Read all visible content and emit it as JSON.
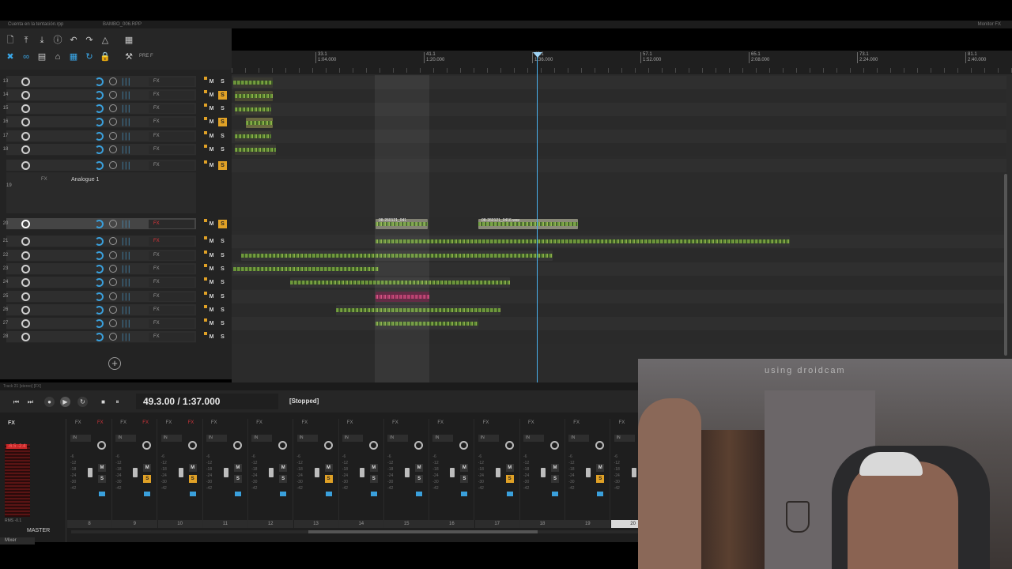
{
  "titlebar": {
    "project_name": "Cuenta en la tentación.rpp",
    "alt_project": "BAMBO_006.RPP",
    "right_text": "Monitor FX"
  },
  "toolbar": {
    "pref_label": "PRE F"
  },
  "ruler": {
    "markers": [
      {
        "bar": "33.1",
        "time": "1:04.000"
      },
      {
        "bar": "41.1",
        "time": "1:20.000"
      },
      {
        "bar": "49.1",
        "time": "1:36.000"
      },
      {
        "bar": "57.1",
        "time": "1:52.000"
      },
      {
        "bar": "65.1",
        "time": "2:08.000"
      },
      {
        "bar": "73.1",
        "time": "2:24.000"
      },
      {
        "bar": "81.1",
        "time": "2:40.000"
      }
    ]
  },
  "tracks": [
    {
      "num": "13",
      "fx": "FX",
      "solo": false
    },
    {
      "num": "14",
      "fx": "FX",
      "solo": true
    },
    {
      "num": "15",
      "fx": "FX",
      "solo": false
    },
    {
      "num": "16",
      "fx": "FX",
      "solo": true
    },
    {
      "num": "17",
      "fx": "FX",
      "solo": false
    },
    {
      "num": "18",
      "fx": "FX",
      "solo": false
    },
    {
      "num": "",
      "fx": "FX",
      "solo": true
    }
  ],
  "folder19": {
    "num": "19",
    "fx_label": "FX",
    "plugin": "Analogue 1"
  },
  "tracks_lower": [
    {
      "num": "20",
      "fx": "FX",
      "solo": true,
      "selected": true,
      "red": true
    },
    {
      "num": "21",
      "fx": "FX",
      "solo": false,
      "red": true
    },
    {
      "num": "22",
      "fx": "FX",
      "solo": false
    },
    {
      "num": "23",
      "fx": "FX",
      "solo": false
    },
    {
      "num": "24",
      "fx": "FX",
      "solo": false
    },
    {
      "num": "25",
      "fx": "FX",
      "solo": false
    },
    {
      "num": "26",
      "fx": "FX",
      "solo": false
    },
    {
      "num": "27",
      "fx": "FX",
      "solo": false
    },
    {
      "num": "28",
      "fx": "FX",
      "solo": false
    }
  ],
  "buttons": {
    "mute": "M",
    "solo": "S",
    "add": "+"
  },
  "items": {
    "clip_a": "08-260121_041",
    "clip_b": "08-260121_0416.wav"
  },
  "status_line": "Track 21 [stereo] [FX]",
  "transport": {
    "time": "49.3.00 / 1:37.000",
    "state": "[Stopped]"
  },
  "mixer": {
    "master_label": "MASTER",
    "master_fx": "FX",
    "master_db": "-6.5  -2.4",
    "rms_label": "RMS  -0.1",
    "in_label": "IN",
    "fx_label": "FX",
    "strips": [
      {
        "num": "8",
        "solo": false
      },
      {
        "num": "9",
        "solo": true
      },
      {
        "num": "10",
        "solo": true
      },
      {
        "num": "11",
        "solo": false
      },
      {
        "num": "12",
        "solo": false
      },
      {
        "num": "13",
        "solo": true
      },
      {
        "num": "14",
        "solo": false
      },
      {
        "num": "15",
        "solo": false
      },
      {
        "num": "16",
        "solo": false
      },
      {
        "num": "17",
        "solo": true
      },
      {
        "num": "18",
        "solo": false
      },
      {
        "num": "19",
        "solo": true
      },
      {
        "num": "20",
        "solo": false,
        "selected": true
      }
    ],
    "tab_label": "Mixer"
  },
  "webcam": {
    "caption": "using droidcam"
  },
  "colors": {
    "accent_blue": "#3aa7e8",
    "solo_yellow": "#e0a126",
    "record_red": "#e0343a",
    "wave_green": "#8fb546",
    "clip_pink": "#b0335e"
  }
}
